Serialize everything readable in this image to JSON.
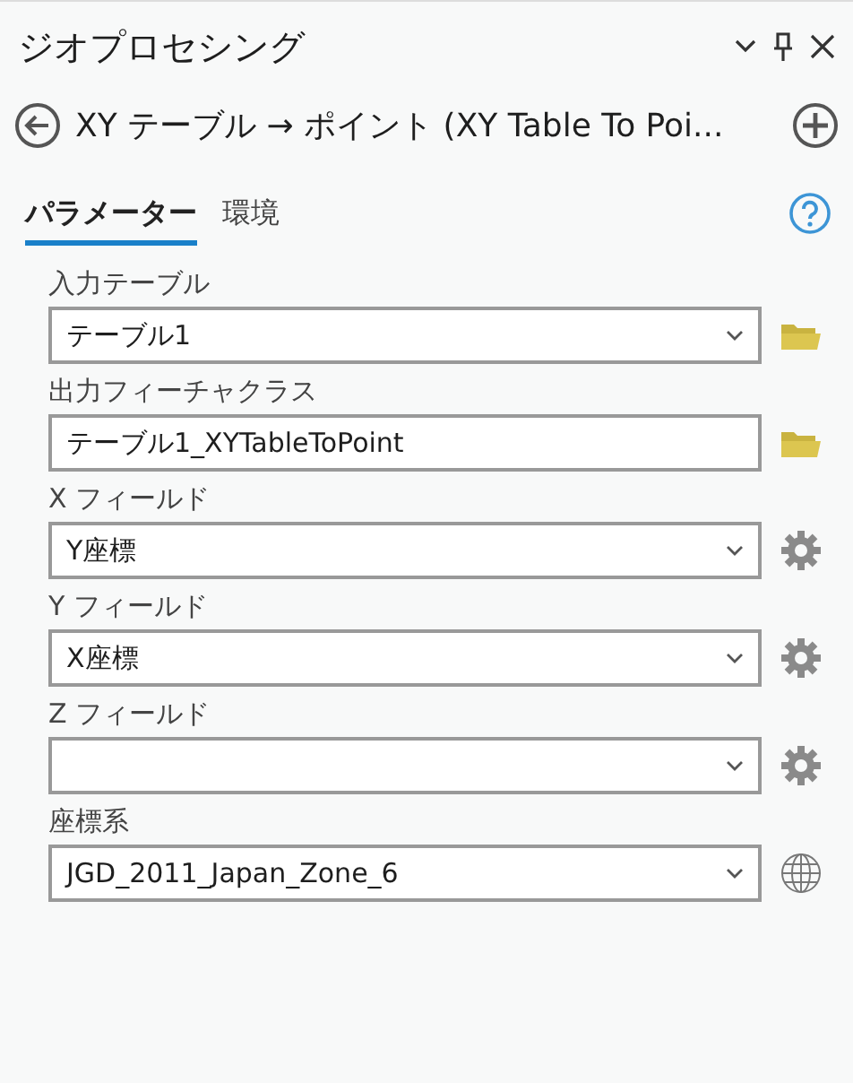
{
  "pane": {
    "title": "ジオプロセシング"
  },
  "tool": {
    "title": "XY テーブル → ポイント (XY Table To Poi..."
  },
  "tabs": [
    {
      "label": "パラメーター",
      "selected": true
    },
    {
      "label": "環境",
      "selected": false
    }
  ],
  "parameters": [
    {
      "label": "入力テーブル",
      "kind": "dropdown",
      "value": "テーブル1",
      "button": {
        "kind": "folder"
      }
    },
    {
      "label": "出力フィーチャクラス",
      "kind": "text",
      "value": "テーブル1_XYTableToPoint",
      "button": {
        "kind": "folder"
      }
    },
    {
      "label": "X フィールド",
      "kind": "dropdown",
      "value": "Y座標",
      "button": {
        "kind": "gear"
      }
    },
    {
      "label": "Y フィールド",
      "kind": "dropdown",
      "value": "X座標",
      "button": {
        "kind": "gear"
      }
    },
    {
      "label": "Z フィールド",
      "kind": "dropdown",
      "button": {
        "kind": "gear"
      }
    },
    {
      "label": "座標系",
      "kind": "dropdown",
      "value": "JGD_2011_Japan_Zone_6",
      "button": {
        "kind": "globe"
      }
    }
  ]
}
